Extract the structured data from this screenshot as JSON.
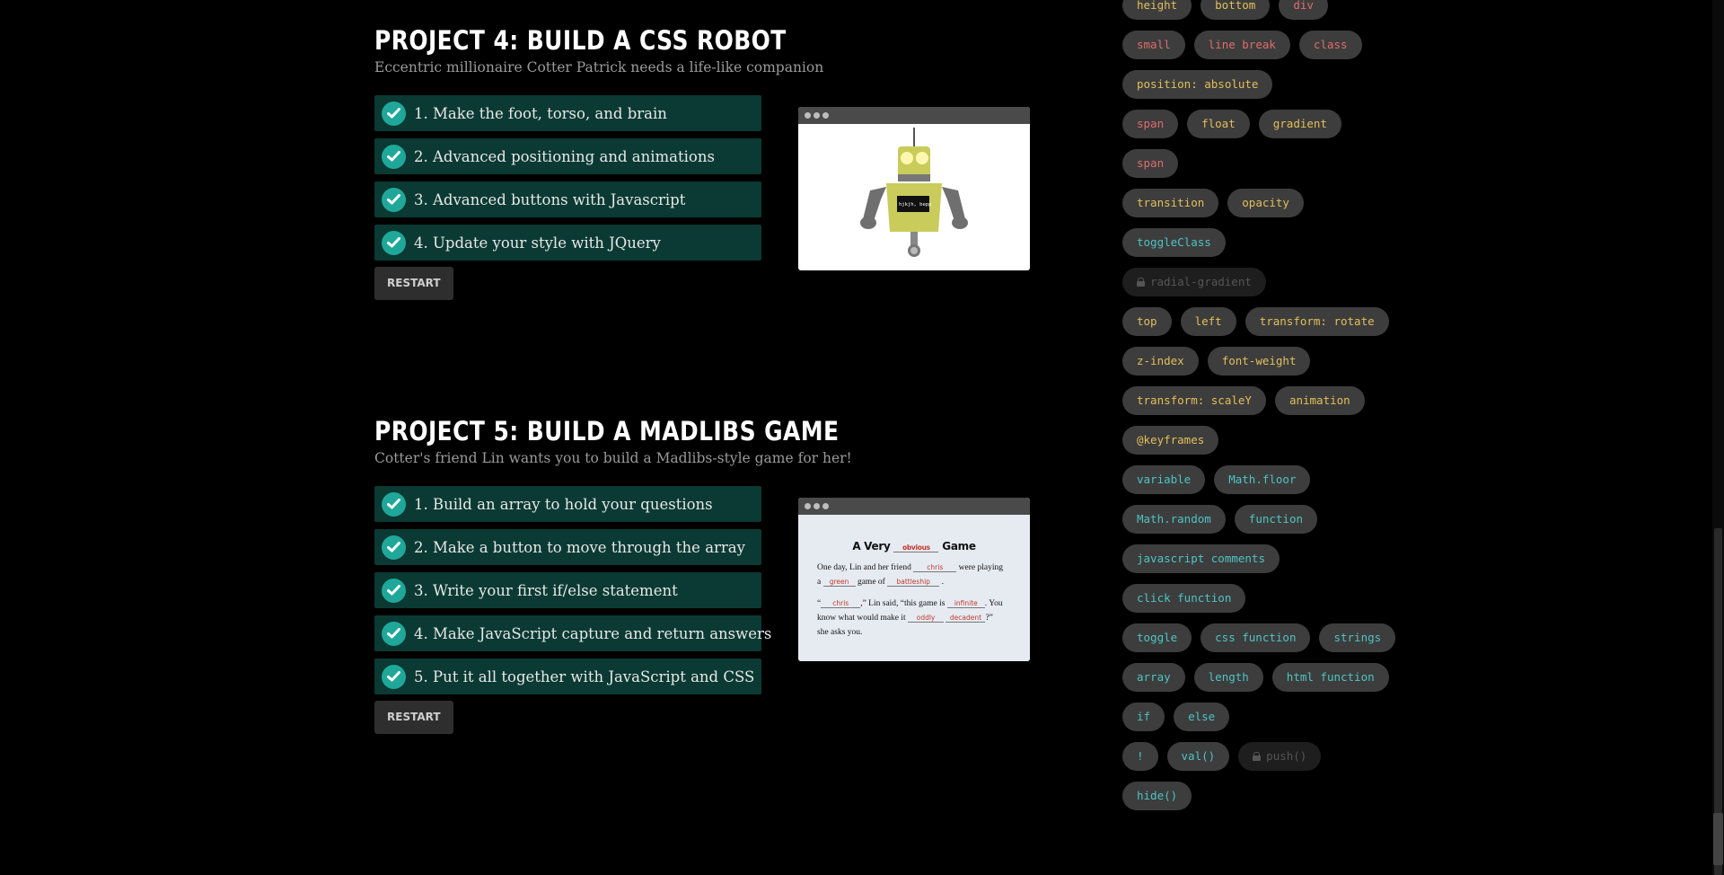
{
  "projects": [
    {
      "title": "PROJECT 4: BUILD A CSS ROBOT",
      "subtitle": "Eccentric millionaire Cotter Patrick needs a life-like companion",
      "steps": [
        "1. Make the foot, torso, and brain",
        "2. Advanced positioning and animations",
        "3. Advanced buttons with Javascript",
        "4. Update your style with JQuery"
      ],
      "restart_label": "RESTART",
      "preview_screen_text": "hjkjh, bepp"
    },
    {
      "title": "PROJECT 5: BUILD A MADLIBS GAME",
      "subtitle": "Cotter's friend Lin wants you to build a Madlibs-style game for her!",
      "steps": [
        "1. Build an array to hold your questions",
        "2. Make a button to move through the array",
        "3. Write your first if/else statement",
        "4. Make JavaScript capture and return answers",
        "5. Put it all together with JavaScript and CSS"
      ],
      "restart_label": "RESTART",
      "madlibs": {
        "title_pre": "A Very",
        "title_blank": "obvious",
        "title_post": "Game",
        "line1_pre": "One day, Lin and her friend",
        "line1_blank": "chris",
        "line1_post": "were playing",
        "line2_pre": "a",
        "line2_blank": "green",
        "line2_mid": "game of",
        "line2_blank2": "battleship",
        "line2_post": ".",
        "line3_pre": "“",
        "line3_blank": "chris",
        "line3_mid": ",” Lin said, “this game is",
        "line3_blank2": "infinite",
        "line3_post": ". You",
        "line4_pre": "know what would make it",
        "line4_blank": "oddly",
        "line4_blank2": "decadent",
        "line4_post": "?”",
        "line5": "she asks you."
      }
    }
  ],
  "tag_rows": [
    [
      {
        "label": "height",
        "kind": "css"
      },
      {
        "label": "bottom",
        "kind": "css"
      },
      {
        "label": "div",
        "kind": "html"
      }
    ],
    [
      {
        "label": "small",
        "kind": "html"
      },
      {
        "label": "line break",
        "kind": "html"
      },
      {
        "label": "class",
        "kind": "html"
      }
    ],
    [
      {
        "label": "position: absolute",
        "kind": "css"
      }
    ],
    [
      {
        "label": "span",
        "kind": "html"
      },
      {
        "label": "float",
        "kind": "css"
      },
      {
        "label": "gradient",
        "kind": "css"
      }
    ],
    [
      {
        "label": "span",
        "kind": "html"
      }
    ],
    [
      {
        "label": "transition",
        "kind": "css"
      },
      {
        "label": "opacity",
        "kind": "css"
      }
    ],
    [
      {
        "label": "toggleClass",
        "kind": "js"
      }
    ],
    [
      {
        "label": "radial-gradient",
        "kind": "locked"
      }
    ],
    [
      {
        "label": "top",
        "kind": "css"
      },
      {
        "label": "left",
        "kind": "css"
      },
      {
        "label": "transform: rotate",
        "kind": "css"
      }
    ],
    [
      {
        "label": "z-index",
        "kind": "css"
      },
      {
        "label": "font-weight",
        "kind": "css"
      }
    ],
    [
      {
        "label": "transform: scaleY",
        "kind": "css"
      },
      {
        "label": "animation",
        "kind": "css"
      }
    ],
    [
      {
        "label": "@keyframes",
        "kind": "css"
      }
    ],
    [
      {
        "label": "variable",
        "kind": "js"
      },
      {
        "label": "Math.floor",
        "kind": "js"
      }
    ],
    [
      {
        "label": "Math.random",
        "kind": "js"
      },
      {
        "label": "function",
        "kind": "js"
      }
    ],
    [
      {
        "label": "javascript comments",
        "kind": "js"
      }
    ],
    [
      {
        "label": "click function",
        "kind": "js"
      }
    ],
    [
      {
        "label": "toggle",
        "kind": "js"
      },
      {
        "label": "css function",
        "kind": "js"
      },
      {
        "label": "strings",
        "kind": "js"
      }
    ],
    [
      {
        "label": "array",
        "kind": "js"
      },
      {
        "label": "length",
        "kind": "js"
      },
      {
        "label": "html function",
        "kind": "js"
      }
    ],
    [
      {
        "label": "if",
        "kind": "js"
      },
      {
        "label": "else",
        "kind": "js"
      }
    ],
    [
      {
        "label": "!",
        "kind": "js"
      },
      {
        "label": "val()",
        "kind": "js"
      },
      {
        "label": "push()",
        "kind": "locked"
      }
    ],
    [
      {
        "label": "hide()",
        "kind": "js"
      }
    ]
  ],
  "colors": {
    "step_bg": "#0a3a33",
    "check": "#1fa89a",
    "tag_html": "#e06c6c",
    "tag_css": "#e3bf5a",
    "tag_js": "#4fc3c3",
    "robot_body": "#c9cc5a"
  }
}
